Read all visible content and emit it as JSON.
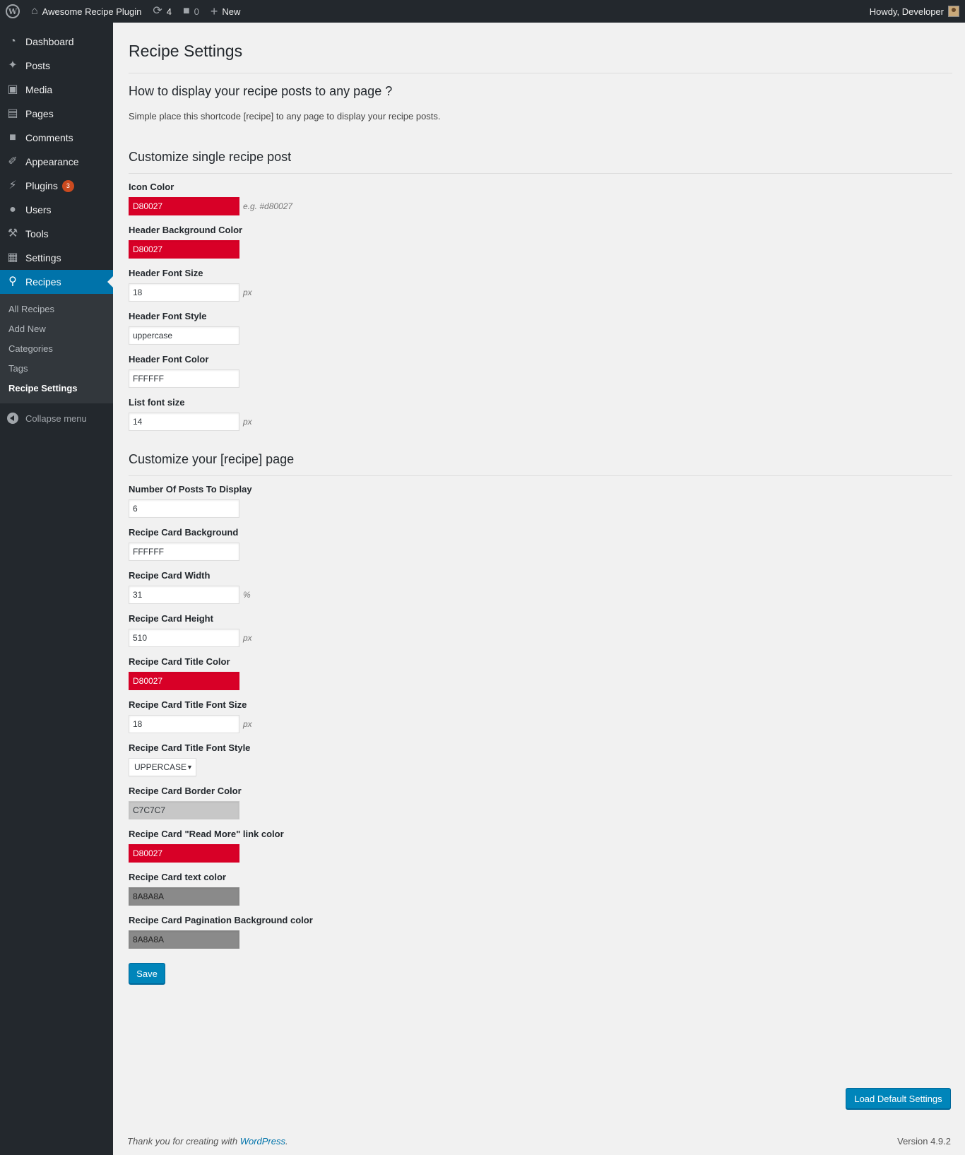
{
  "adminbar": {
    "site_name": "Awesome Recipe Plugin",
    "updates_count": "4",
    "comments_count": "0",
    "new_label": "New",
    "greeting": "Howdy, Developer"
  },
  "sidebar": {
    "items": [
      {
        "label": "Dashboard",
        "icon": "dashboard-icon"
      },
      {
        "label": "Posts",
        "icon": "pin-icon"
      },
      {
        "label": "Media",
        "icon": "media-icon"
      },
      {
        "label": "Pages",
        "icon": "pages-icon"
      },
      {
        "label": "Comments",
        "icon": "comment-icon"
      },
      {
        "label": "Appearance",
        "icon": "brush-icon"
      },
      {
        "label": "Plugins",
        "icon": "plugin-icon",
        "badge": "3"
      },
      {
        "label": "Users",
        "icon": "user-icon"
      },
      {
        "label": "Tools",
        "icon": "wrench-icon"
      },
      {
        "label": "Settings",
        "icon": "settings-icon"
      },
      {
        "label": "Recipes",
        "icon": "fork-knife-icon"
      }
    ],
    "submenu": [
      "All Recipes",
      "Add New",
      "Categories",
      "Tags",
      "Recipe Settings"
    ],
    "collapse_label": "Collapse menu"
  },
  "main": {
    "title": "Recipe Settings",
    "how_to_heading": "How to display your recipe posts to any page ?",
    "how_to_text": "Simple place this shortcode [recipe] to any page to display your recipe posts.",
    "single_heading": "Customize single recipe post",
    "icon_color_label": "Icon Color",
    "icon_color_value": "D80027",
    "icon_color_hint": "e.g. #d80027",
    "header_bg_label": "Header Background Color",
    "header_bg_value": "D80027",
    "header_font_size_label": "Header Font Size",
    "header_font_size_value": "18",
    "header_font_style_label": "Header Font Style",
    "header_font_style_value": "uppercase",
    "header_font_color_label": "Header Font Color",
    "header_font_color_value": "FFFFFF",
    "list_font_size_label": "List font size",
    "list_font_size_value": "14",
    "page_heading": "Customize your [recipe] page",
    "num_posts_label": "Number Of Posts To Display",
    "num_posts_value": "6",
    "card_bg_label": "Recipe Card Background",
    "card_bg_value": "FFFFFF",
    "card_width_label": "Recipe Card Width",
    "card_width_value": "31",
    "card_height_label": "Recipe Card Height",
    "card_height_value": "510",
    "card_title_color_label": "Recipe Card Title Color",
    "card_title_color_value": "D80027",
    "card_title_font_size_label": "Recipe Card Title Font Size",
    "card_title_font_size_value": "18",
    "card_title_font_style_label": "Recipe Card Title Font Style",
    "card_title_font_style_value": "UPPERCASE",
    "card_border_label": "Recipe Card Border Color",
    "card_border_value": "C7C7C7",
    "read_more_label": "Recipe Card \"Read More\" link color",
    "read_more_value": "D80027",
    "text_color_label": "Recipe Card text color",
    "text_color_value": "8A8A8A",
    "pagination_bg_label": "Recipe Card Pagination Background color",
    "pagination_bg_value": "8A8A8A",
    "unit_px": "px",
    "unit_percent": "%",
    "save_label": "Save",
    "load_defaults_label": "Load Default Settings"
  },
  "footer": {
    "thanks_prefix": "Thank you for creating with ",
    "wordpress_link": "WordPress",
    "thanks_suffix": ".",
    "version": "Version 4.9.2"
  },
  "colors": {
    "accent": "#0073aa",
    "button": "#0085ba",
    "red": "#d80027",
    "sidebar_bg": "#23282d"
  }
}
